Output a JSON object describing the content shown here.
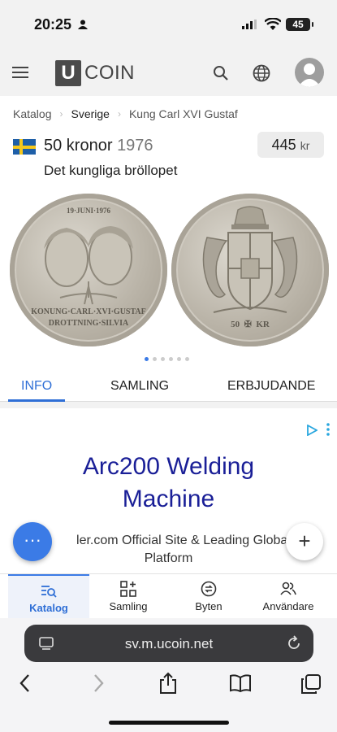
{
  "status_bar": {
    "time": "20:25",
    "battery": "45"
  },
  "header": {
    "logo_letter": "U",
    "logo_text": "COIN"
  },
  "breadcrumb": [
    "Katalog",
    "Sverige",
    "Kung Carl XVI Gustaf"
  ],
  "coin": {
    "denomination": "50 kronor",
    "year": "1976",
    "subtitle": "Det kungliga bröllopet",
    "price": "445",
    "currency": "kr",
    "obverse_text": {
      "date": "19·JUNI·1976",
      "line1": "KONUNG·CARL·XVI·GUSTAF",
      "line2": "DROTTNING·SILVIA"
    },
    "reverse_text": {
      "value": "50",
      "unit": "KR"
    }
  },
  "carousel": {
    "count": 6,
    "active": 0
  },
  "tabs": [
    "INFO",
    "SAMLING",
    "ERBJUDANDE"
  ],
  "ad": {
    "title_line1": "Arc200 Welding",
    "title_line2": "Machine",
    "desc_line1": "ler.com Official Site & Leading Global B",
    "desc_line2": "Platform"
  },
  "fab": {
    "more": "···",
    "add": "+"
  },
  "bottom_nav": [
    {
      "label": "Katalog",
      "icon": "catalog-search-icon"
    },
    {
      "label": "Samling",
      "icon": "grid-plus-icon"
    },
    {
      "label": "Byten",
      "icon": "exchange-icon"
    },
    {
      "label": "Användare",
      "icon": "users-icon"
    }
  ],
  "browser": {
    "url": "sv.m.ucoin.net"
  },
  "colors": {
    "accent": "#3b7be6",
    "ad_title": "#1a1f97",
    "flag_blue": "#1e5fa8",
    "flag_yellow": "#f6c81c"
  }
}
